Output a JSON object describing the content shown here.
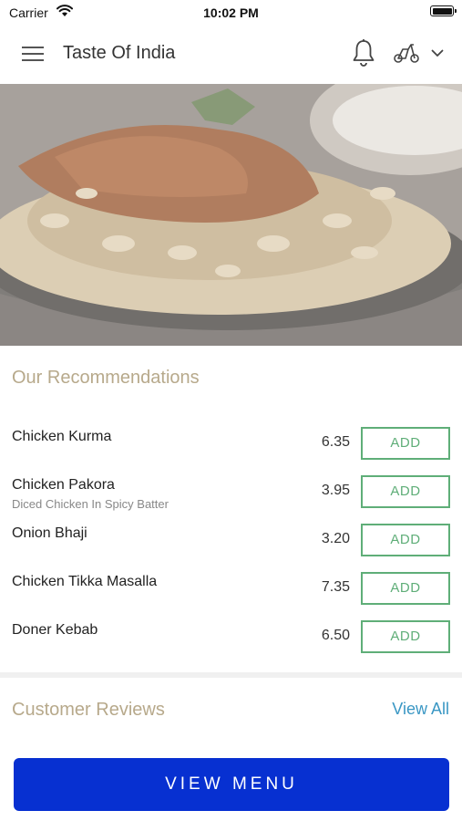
{
  "status_bar": {
    "carrier": "Carrier",
    "time": "10:02 PM"
  },
  "header": {
    "title": "Taste Of India",
    "icons": [
      "menu-icon",
      "bell-icon",
      "scooter-icon",
      "chevron-down-icon"
    ]
  },
  "hero": {
    "image": "biryani-dish-photo"
  },
  "recommendations": {
    "title": "Our Recommendations",
    "items": [
      {
        "name": "Chicken Kurma",
        "description": "",
        "price": "6.35",
        "button": "ADD"
      },
      {
        "name": "Chicken Pakora",
        "description": "Diced Chicken In Spicy Batter",
        "price": "3.95",
        "button": "ADD"
      },
      {
        "name": "Onion Bhaji",
        "description": "",
        "price": "3.20",
        "button": "ADD"
      },
      {
        "name": "Chicken Tikka Masalla",
        "description": "",
        "price": "7.35",
        "button": "ADD"
      },
      {
        "name": "Doner Kebab",
        "description": "",
        "price": "6.50",
        "button": "ADD"
      }
    ]
  },
  "reviews": {
    "title": "Customer Reviews",
    "view_all": "View All"
  },
  "cta": {
    "label": "VIEW MENU"
  },
  "colors": {
    "accent_gold": "#b7a98b",
    "add_green": "#5fae78",
    "link_blue": "#3a97c4",
    "cta_blue": "#0730d1"
  }
}
